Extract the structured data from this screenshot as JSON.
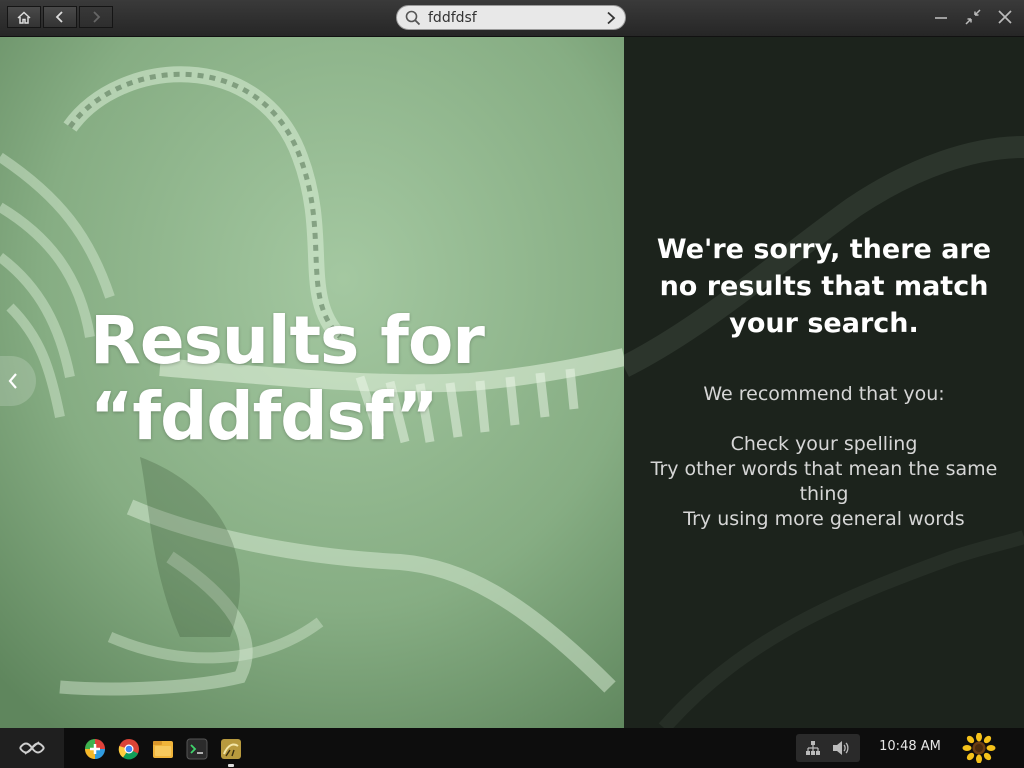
{
  "titlebar": {
    "home_icon": "home-icon",
    "back_icon": "chevron-left-icon",
    "forward_icon": "chevron-right-icon",
    "window_controls": [
      "minimize-icon",
      "unmaximize-icon",
      "close-icon"
    ]
  },
  "search": {
    "value": "fddfdsf",
    "search_icon": "search-icon",
    "go_icon": "chevron-right-icon"
  },
  "hero": {
    "title_line1": "Results for",
    "title_line2": "“fddfdsf”"
  },
  "panel": {
    "sorry_text": "We're sorry, there are no results that match your search.",
    "recommend_label": "We recommend that you:",
    "tips": [
      "Check your spelling",
      "Try other words that mean the same thing",
      "Try using more general words"
    ]
  },
  "taskbar": {
    "apps": [
      "app-store-icon",
      "chrome-icon",
      "files-icon",
      "terminal-icon",
      "encyclopedia-icon"
    ],
    "tray_icons": [
      "network-icon",
      "volume-icon"
    ],
    "clock": "10:48 AM",
    "user_icon": "sunflower-icon"
  },
  "colors": {
    "hero_green": "#7fa77f",
    "panel_dark": "#1c231c",
    "taskbar": "#0d0d0d",
    "titlebar": "#2f2f2f"
  }
}
